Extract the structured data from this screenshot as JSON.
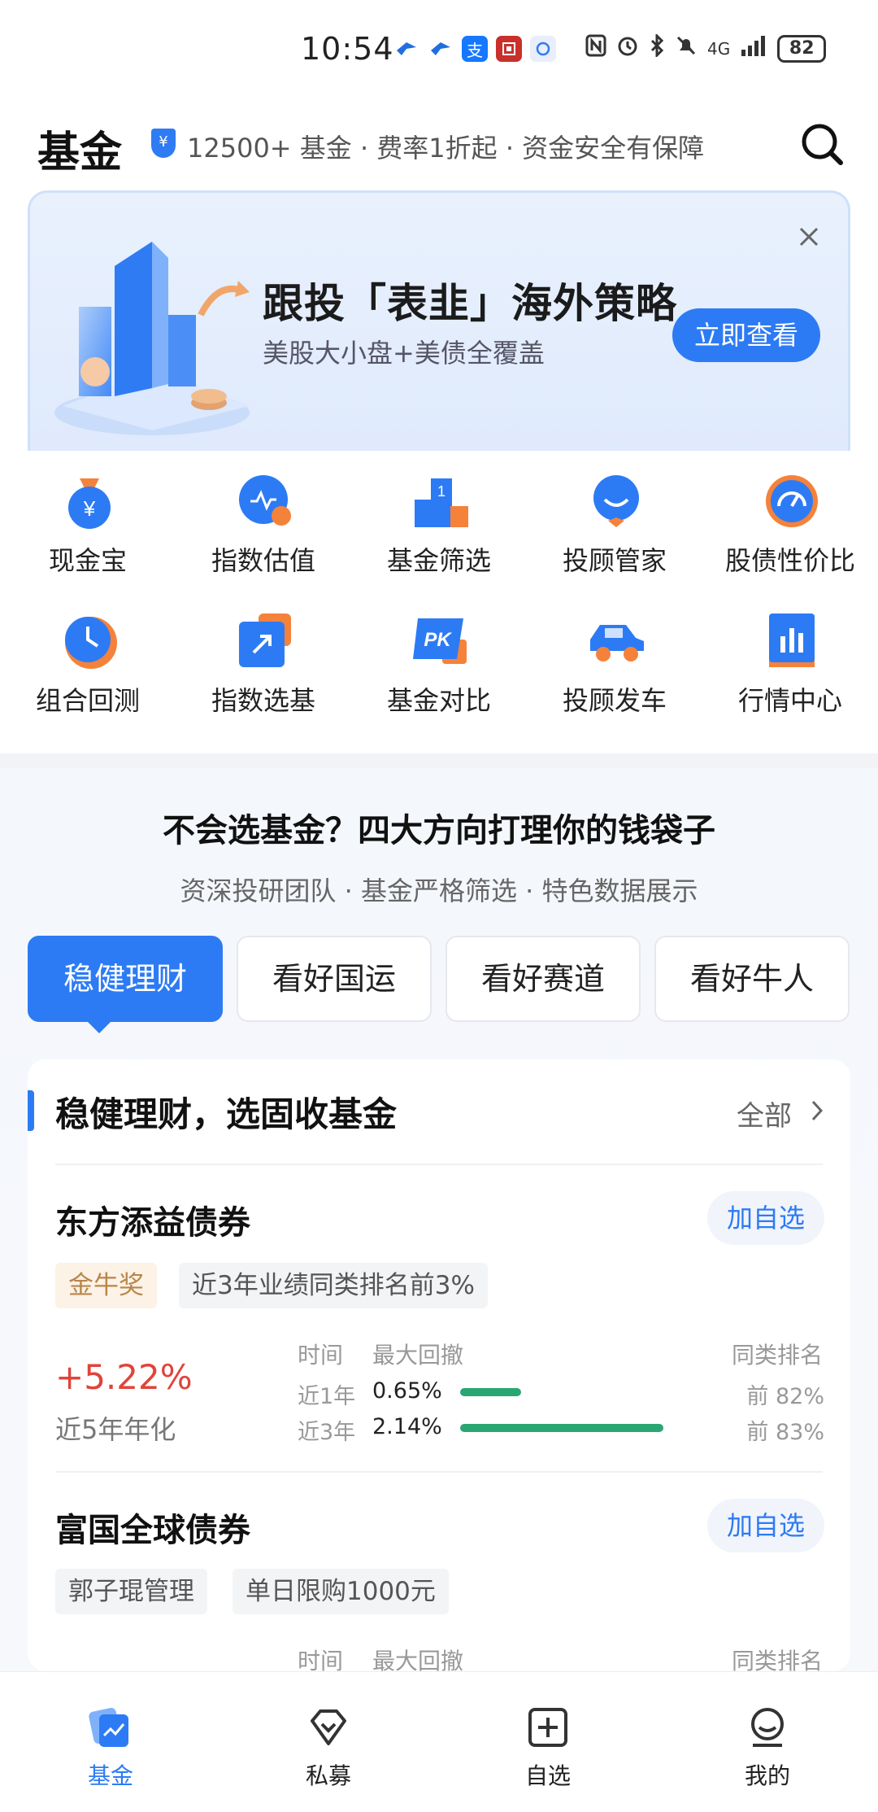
{
  "status_bar": {
    "time": "10:54",
    "network": "4G",
    "battery": "82",
    "app_icons": [
      "bird-app-icon",
      "bird-app-icon-2",
      "alipay-icon",
      "bank-icon",
      "wechat-pay-icon"
    ]
  },
  "header": {
    "title": "基金",
    "shield_glyph": "¥",
    "tagline": "12500+ 基金 · 费率1折起 · 资金安全有保障"
  },
  "banner": {
    "title": "跟投「表韭」海外策略",
    "subtitle": "美股大小盘+美债全覆盖",
    "button": "立即查看"
  },
  "shortcuts": [
    {
      "label": "现金宝",
      "icon": "money-bag-icon"
    },
    {
      "label": "指数估值",
      "icon": "pulse-icon"
    },
    {
      "label": "基金筛选",
      "icon": "podium-icon"
    },
    {
      "label": "投顾管家",
      "icon": "butler-icon"
    },
    {
      "label": "股债性价比",
      "icon": "gauge-icon"
    },
    {
      "label": "组合回测",
      "icon": "clock-icon"
    },
    {
      "label": "指数选基",
      "icon": "arrow-box-icon"
    },
    {
      "label": "基金对比",
      "icon": "pk-icon"
    },
    {
      "label": "投顾发车",
      "icon": "car-icon"
    },
    {
      "label": "行情中心",
      "icon": "bar-chart-icon"
    }
  ],
  "section": {
    "title": "不会选基金？四大方向打理你的钱袋子",
    "subtitle": "资深投研团队 · 基金严格筛选 · 特色数据展示",
    "tabs": [
      "稳健理财",
      "看好国运",
      "看好赛道",
      "看好牛人"
    ],
    "active_tab": 0
  },
  "card": {
    "title": "稳健理财，选固收基金",
    "all_label": "全部",
    "col_time": "时间",
    "col_drawdown": "最大回撤",
    "col_rank": "同类排名",
    "funds": [
      {
        "name": "东方添益债券",
        "add_label": "加自选",
        "tags": [
          "金牛奖",
          "近3年业绩同类排名前3%"
        ],
        "return_value": "+5.22%",
        "return_label": "近5年年化",
        "rows": [
          {
            "period": "近1年",
            "drawdown": "0.65%",
            "drawdown_level": 0.3,
            "rank": "前 82%"
          },
          {
            "period": "近3年",
            "drawdown": "2.14%",
            "drawdown_level": 1.0,
            "rank": "前 83%"
          }
        ]
      },
      {
        "name": "富国全球债券",
        "add_label": "加自选",
        "tags": [
          "郭子琨管理",
          "单日限购1000元"
        ]
      }
    ]
  },
  "bottom_nav": [
    {
      "label": "基金",
      "icon": "fund-card-icon",
      "active": true
    },
    {
      "label": "私募",
      "icon": "diamond-icon",
      "active": false
    },
    {
      "label": "自选",
      "icon": "plus-box-icon",
      "active": false
    },
    {
      "label": "我的",
      "icon": "user-icon",
      "active": false
    }
  ],
  "colors": {
    "accent": "#2d7bf4",
    "orange": "#f5823a",
    "positive": "#e0443a",
    "bar": "#2aa673"
  }
}
